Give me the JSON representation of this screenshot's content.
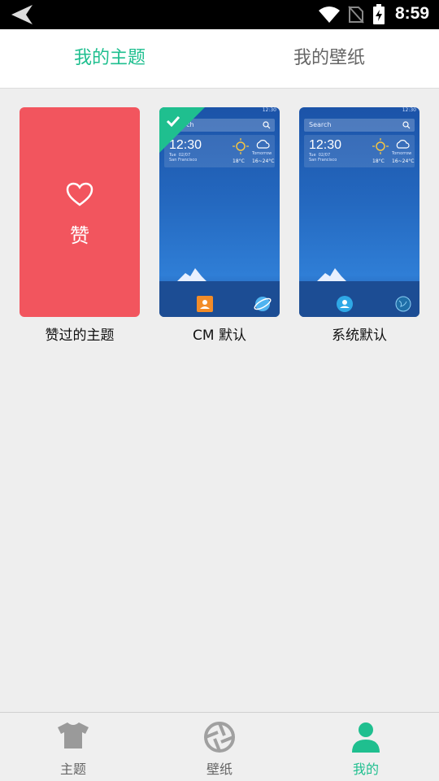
{
  "status_bar": {
    "time": "8:59"
  },
  "top_tabs": [
    {
      "label": "我的主题",
      "active": true
    },
    {
      "label": "我的壁纸",
      "active": false
    }
  ],
  "themes": [
    {
      "label": "赞过的主题",
      "card_text": "赞",
      "type": "liked"
    },
    {
      "label": "CM 默认",
      "type": "preview",
      "selected": true,
      "search": "rch",
      "clock": "12:30",
      "date": "Tue  02/07\nSan Francisco",
      "temp_today": "18°C",
      "tomorrow": "Tomorrow",
      "temp_tomorrow": "16~24°C",
      "status_time": "12:30"
    },
    {
      "label": "系统默认",
      "type": "preview",
      "selected": false,
      "search": "Search",
      "clock": "12:30",
      "date": "Tue  02/07\nSan Francisco",
      "temp_today": "18°C",
      "tomorrow": "Tomorrow",
      "temp_tomorrow": "16~24°C",
      "status_time": "12:30"
    }
  ],
  "bottom_nav": [
    {
      "label": "主题",
      "icon": "tshirt-icon",
      "active": false
    },
    {
      "label": "壁纸",
      "icon": "aperture-icon",
      "active": false
    },
    {
      "label": "我的",
      "icon": "person-icon",
      "active": true
    }
  ],
  "colors": {
    "accent": "#1fbf8f",
    "liked_card": "#f2555e"
  }
}
